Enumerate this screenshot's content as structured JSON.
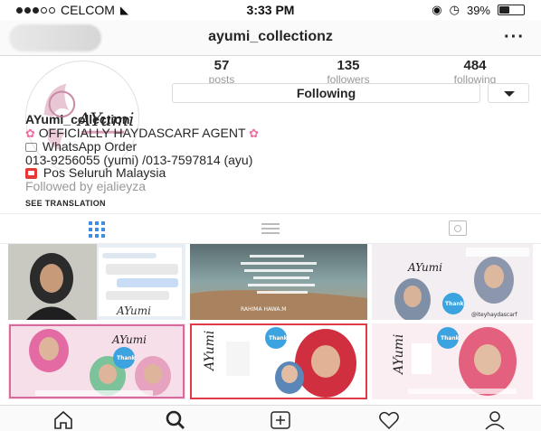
{
  "status_bar": {
    "carrier": "CELCOM",
    "time": "3:33 PM",
    "battery": "39%",
    "battery_level": 0.39
  },
  "nav": {
    "title": "ayumi_collectionz",
    "more": "···"
  },
  "profile": {
    "stats": [
      {
        "value": "57",
        "label": "posts"
      },
      {
        "value": "135",
        "label": "followers"
      },
      {
        "value": "484",
        "label": "following"
      }
    ],
    "following_button": "Following",
    "name": "AYumi_collection",
    "bio_lines": [
      "OFFICIALLY HAYDASCARF AGENT",
      "WhatsApp Order",
      "013-9256055 (yumi) /013-7597814 (ayu)",
      "Pos Seluruh Malaysia"
    ],
    "followed_by": "Followed by ejalieyza",
    "see_translation": "SEE TRANSLATION",
    "avatar_text": "AYumi"
  },
  "colors": {
    "accent_blue": "#3f8ee0",
    "flower_pink": "#f26fa2",
    "pin_red": "#e53935"
  },
  "icons": {
    "grid_view": "grid-view-icon",
    "list_view": "list-view-icon",
    "tagged_view": "tagged-icon",
    "home": "home-icon",
    "search": "search-icon",
    "add": "add-post-icon",
    "activity": "heart-icon",
    "profile": "profile-icon"
  },
  "posts": [
    {
      "caption": ""
    },
    {
      "caption": "YA ALLAH BUKAKANLAH BAGI KAMI PINTU KEBAIKAN, PINTU KEBERKATAN, PINTU KENIKMATAN, PINTU KESELAMATAN, PINTU KESIHATAN, PINTU KEKUATAN DAN PINTU SYURGA.",
      "credit": "RAHIMA HAWA.M"
    },
    {
      "caption": "Thank you"
    },
    {
      "caption": "Thank you"
    },
    {
      "caption": "Thank you"
    },
    {
      "caption": ""
    }
  ]
}
